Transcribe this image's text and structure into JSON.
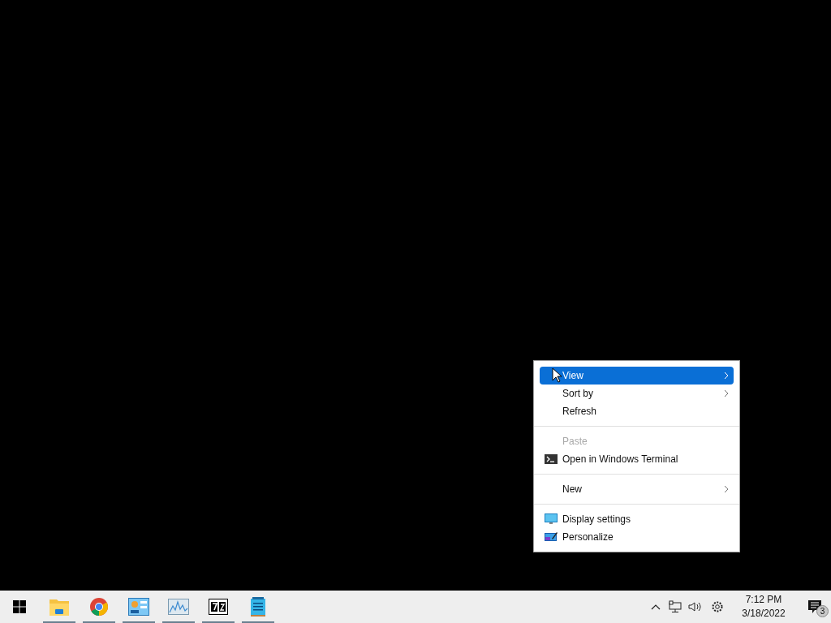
{
  "context_menu": {
    "items": [
      {
        "kind": "text",
        "label": "View",
        "submenu": true,
        "disabled": false,
        "selected": true
      },
      {
        "kind": "text",
        "label": "Sort by",
        "submenu": true,
        "disabled": false,
        "selected": false
      },
      {
        "kind": "text",
        "label": "Refresh",
        "submenu": false,
        "disabled": false,
        "selected": false
      },
      {
        "kind": "separator"
      },
      {
        "kind": "text",
        "label": "Paste",
        "submenu": false,
        "disabled": true,
        "selected": false
      },
      {
        "kind": "terminal",
        "label": "Open in Windows Terminal",
        "submenu": false,
        "disabled": false,
        "selected": false
      },
      {
        "kind": "separator"
      },
      {
        "kind": "text",
        "label": "New",
        "submenu": true,
        "disabled": false,
        "selected": false
      },
      {
        "kind": "separator"
      },
      {
        "kind": "display",
        "label": "Display settings",
        "submenu": false,
        "disabled": false,
        "selected": false
      },
      {
        "kind": "personalize",
        "label": "Personalize",
        "submenu": false,
        "disabled": false,
        "selected": false
      }
    ]
  },
  "taskbar": {
    "apps": [
      {
        "kind": "folder",
        "open": true
      },
      {
        "kind": "browser",
        "open": true
      },
      {
        "kind": "dashboard",
        "open": true
      },
      {
        "kind": "monitor",
        "open": true
      },
      {
        "kind": "archiver",
        "open": true
      },
      {
        "kind": "notepad",
        "open": true
      }
    ],
    "time": "7:12 PM",
    "date": "3/18/2022",
    "notification_count": "3"
  }
}
